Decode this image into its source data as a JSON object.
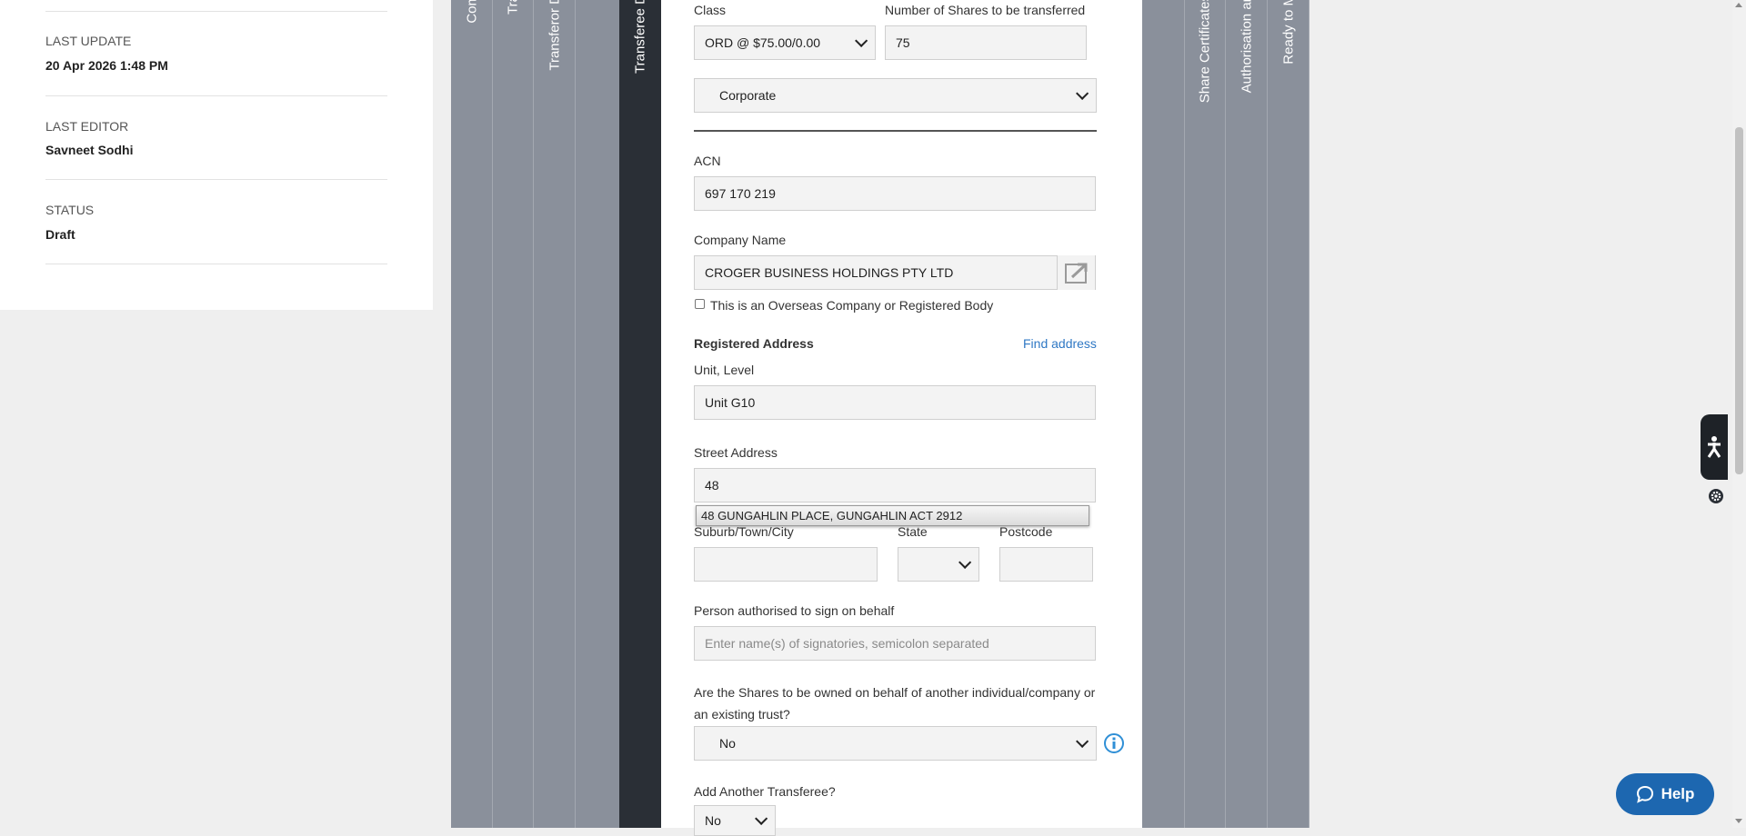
{
  "meta_panel": {
    "last_update_label": "LAST UPDATE",
    "last_update_value": "20 Apr 2026 1:48 PM",
    "last_editor_label": "LAST EDITOR",
    "last_editor_value": "Savneet Sodhi",
    "status_label": "STATUS",
    "status_value": "Draft"
  },
  "wizard_tabs": [
    {
      "label": "Com",
      "active": false
    },
    {
      "label": "Tra",
      "active": false
    },
    {
      "label": "Transferor D",
      "active": false
    },
    {
      "label": "Transferee D",
      "active": true
    },
    {
      "label": "Share Certificates",
      "active": false
    },
    {
      "label": "Authorisation an",
      "active": false
    },
    {
      "label": "Ready to M",
      "active": false
    }
  ],
  "form": {
    "class_label": "Class",
    "class_value": "ORD @ $75.00/0.00",
    "shares_label": "Number of Shares to be transferred",
    "shares_value": "75",
    "entity_type_value": "Corporate",
    "acn_label": "ACN",
    "acn_value": "697 170 219",
    "company_name_label": "Company Name",
    "company_name_value": "CROGER BUSINESS HOLDINGS PTY LTD",
    "overseas_checkbox_label": "This is an Overseas Company or Registered Body",
    "registered_address_heading": "Registered Address",
    "find_address_link": "Find address",
    "unit_label": "Unit, Level",
    "unit_value": "Unit G10",
    "street_label": "Street Address",
    "street_value": "48",
    "street_suggestion": "48 GUNGAHLIN PLACE, GUNGAHLIN ACT 2912",
    "suburb_label": "Suburb/Town/City",
    "state_label": "State",
    "postcode_label": "Postcode",
    "signatory_label": "Person authorised to sign on behalf",
    "signatory_placeholder": "Enter name(s) of signatories, semicolon separated",
    "behalf_question_line1": "Are the Shares to be owned on behalf of another individual/company or",
    "behalf_question_line2": "an existing trust?",
    "behalf_value": "No",
    "add_transferee_label": "Add Another Transferee?",
    "add_transferee_value": "No"
  },
  "help_button_label": "Help"
}
